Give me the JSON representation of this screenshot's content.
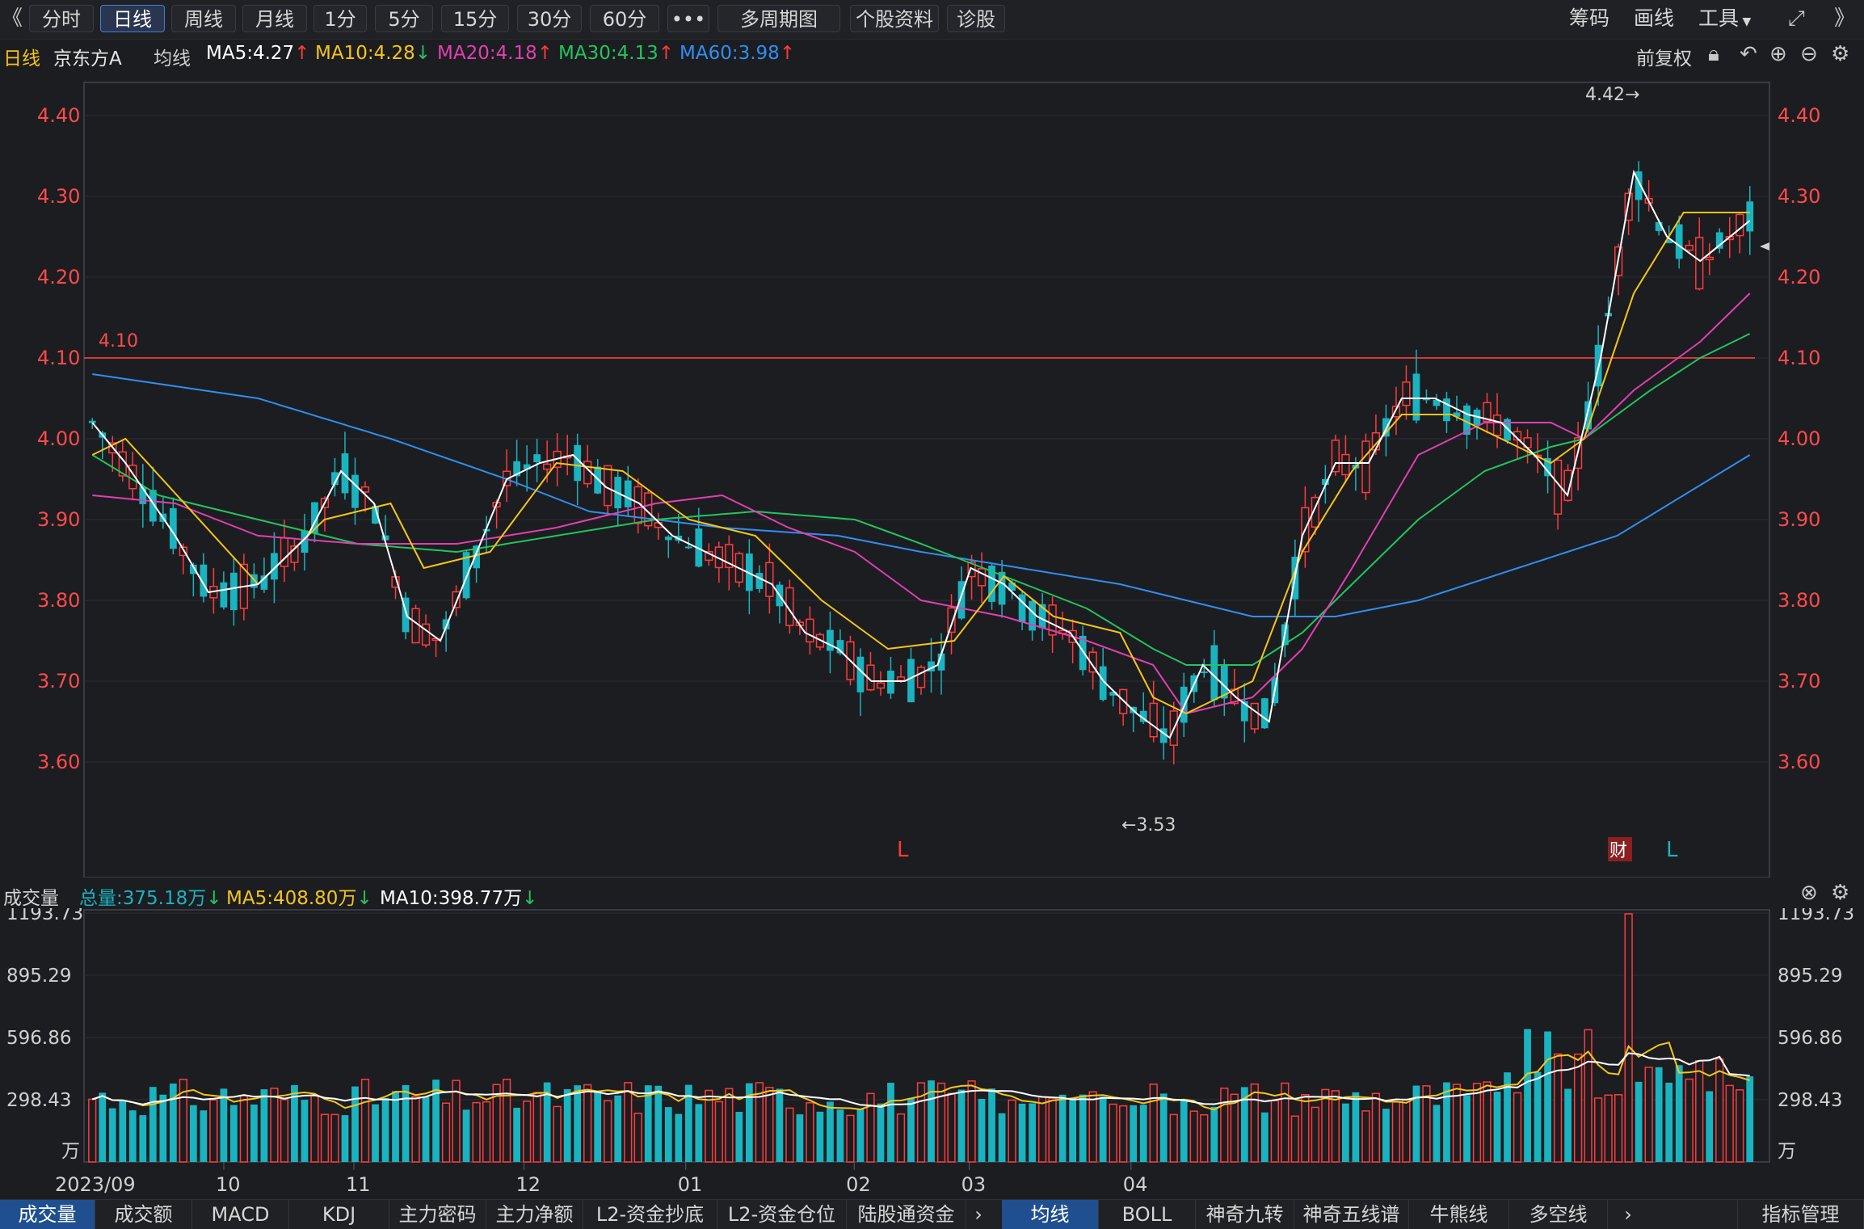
{
  "toolbar": {
    "collapse_left": "《",
    "tabs": [
      "分时",
      "日线",
      "周线",
      "月线",
      "1分",
      "5分",
      "15分",
      "30分",
      "60分",
      "•••",
      "多周期图",
      "个股资料",
      "诊股"
    ],
    "active_tab": "日线",
    "right_tools": [
      "筹码",
      "画线",
      "工具"
    ],
    "expand_right": "》"
  },
  "info": {
    "period": "日线",
    "stock_name": "京东方A",
    "ma_label": "均线",
    "ma5": "MA5:4.27",
    "ma10": "MA10:4.28",
    "ma20": "MA20:4.18",
    "ma30": "MA30:4.13",
    "ma60": "MA60:3.98",
    "adjust": "前复权"
  },
  "colors": {
    "up": "#ff3b3b",
    "down": "#1ab3c0",
    "ma5": "#ffffff",
    "ma10": "#f5c518",
    "ma20": "#e040b0",
    "ma30": "#22c55e",
    "ma60": "#2f8ff0",
    "grid": "#2c2d33",
    "ref_line": "#d33a3a"
  },
  "price_axis": {
    "ticks": [
      "4.40",
      "4.30",
      "4.20",
      "4.10",
      "4.00",
      "3.90",
      "3.80",
      "3.70",
      "3.60"
    ],
    "ref_line_label": "4.10",
    "high_label": "4.42→",
    "low_label": "←3.53",
    "markers": [
      "L",
      "财",
      "L"
    ]
  },
  "volume": {
    "title": "成交量",
    "total": "总量:375.18万",
    "ma5": "MA5:408.80万",
    "ma10": "MA10:398.77万",
    "ticks": [
      "1193.73",
      "895.29",
      "596.86",
      "298.43"
    ],
    "unit": "万"
  },
  "x_labels": [
    "2023/09",
    "10",
    "11",
    "12",
    "01",
    "02",
    "03",
    "04"
  ],
  "bottom_tabs_left": [
    "成交量",
    "成交额",
    "MACD",
    "KDJ",
    "主力密码",
    "主力净额",
    "L2-资金抄底",
    "L2-资金仓位",
    "陆股通资金"
  ],
  "bottom_tabs_right": [
    "均线",
    "BOLL",
    "神奇九转",
    "神奇五线谱",
    "牛熊线",
    "多空线"
  ],
  "indicator_manage": "指标管理",
  "chart_data": {
    "type": "candlestick",
    "title": "京东方A 日线",
    "ylim": [
      3.5,
      4.45
    ],
    "volume_ylim": [
      0,
      1193.73
    ],
    "ma60_path": [
      [
        0,
        4.08
      ],
      [
        0.1,
        4.05
      ],
      [
        0.18,
        4.0
      ],
      [
        0.25,
        3.95
      ],
      [
        0.3,
        3.91
      ],
      [
        0.38,
        3.89
      ],
      [
        0.45,
        3.88
      ],
      [
        0.5,
        3.86
      ],
      [
        0.56,
        3.84
      ],
      [
        0.62,
        3.82
      ],
      [
        0.66,
        3.8
      ],
      [
        0.7,
        3.78
      ],
      [
        0.75,
        3.78
      ],
      [
        0.8,
        3.8
      ],
      [
        0.86,
        3.84
      ],
      [
        0.92,
        3.88
      ],
      [
        0.96,
        3.93
      ],
      [
        1,
        3.98
      ]
    ],
    "ma30_path": [
      [
        0,
        3.98
      ],
      [
        0.04,
        3.93
      ],
      [
        0.1,
        3.9
      ],
      [
        0.16,
        3.87
      ],
      [
        0.22,
        3.86
      ],
      [
        0.28,
        3.88
      ],
      [
        0.34,
        3.9
      ],
      [
        0.4,
        3.91
      ],
      [
        0.46,
        3.9
      ],
      [
        0.5,
        3.87
      ],
      [
        0.55,
        3.83
      ],
      [
        0.6,
        3.79
      ],
      [
        0.64,
        3.74
      ],
      [
        0.66,
        3.72
      ],
      [
        0.7,
        3.72
      ],
      [
        0.73,
        3.76
      ],
      [
        0.76,
        3.82
      ],
      [
        0.8,
        3.9
      ],
      [
        0.84,
        3.96
      ],
      [
        0.88,
        3.99
      ],
      [
        0.9,
        4.0
      ],
      [
        0.94,
        4.06
      ],
      [
        0.97,
        4.1
      ],
      [
        1,
        4.13
      ]
    ],
    "ma20_path": [
      [
        0,
        3.93
      ],
      [
        0.05,
        3.92
      ],
      [
        0.1,
        3.88
      ],
      [
        0.16,
        3.87
      ],
      [
        0.22,
        3.87
      ],
      [
        0.28,
        3.89
      ],
      [
        0.34,
        3.92
      ],
      [
        0.38,
        3.93
      ],
      [
        0.42,
        3.89
      ],
      [
        0.46,
        3.86
      ],
      [
        0.5,
        3.8
      ],
      [
        0.55,
        3.78
      ],
      [
        0.6,
        3.75
      ],
      [
        0.64,
        3.72
      ],
      [
        0.66,
        3.66
      ],
      [
        0.7,
        3.68
      ],
      [
        0.73,
        3.74
      ],
      [
        0.76,
        3.84
      ],
      [
        0.8,
        3.98
      ],
      [
        0.84,
        4.02
      ],
      [
        0.88,
        4.02
      ],
      [
        0.9,
        4.0
      ],
      [
        0.93,
        4.06
      ],
      [
        0.97,
        4.12
      ],
      [
        1,
        4.18
      ]
    ],
    "ma10_path": [
      [
        0,
        3.98
      ],
      [
        0.02,
        4.0
      ],
      [
        0.06,
        3.91
      ],
      [
        0.1,
        3.82
      ],
      [
        0.14,
        3.9
      ],
      [
        0.18,
        3.92
      ],
      [
        0.2,
        3.84
      ],
      [
        0.24,
        3.86
      ],
      [
        0.28,
        3.97
      ],
      [
        0.32,
        3.96
      ],
      [
        0.36,
        3.9
      ],
      [
        0.4,
        3.88
      ],
      [
        0.44,
        3.8
      ],
      [
        0.48,
        3.74
      ],
      [
        0.52,
        3.75
      ],
      [
        0.55,
        3.83
      ],
      [
        0.58,
        3.78
      ],
      [
        0.62,
        3.76
      ],
      [
        0.64,
        3.68
      ],
      [
        0.66,
        3.66
      ],
      [
        0.7,
        3.7
      ],
      [
        0.73,
        3.86
      ],
      [
        0.76,
        3.96
      ],
      [
        0.79,
        4.03
      ],
      [
        0.82,
        4.03
      ],
      [
        0.85,
        4.0
      ],
      [
        0.88,
        3.97
      ],
      [
        0.9,
        4.0
      ],
      [
        0.93,
        4.18
      ],
      [
        0.96,
        4.28
      ],
      [
        1,
        4.28
      ]
    ],
    "ma5_path": [
      [
        0,
        4.02
      ],
      [
        0.02,
        3.97
      ],
      [
        0.05,
        3.88
      ],
      [
        0.07,
        3.81
      ],
      [
        0.1,
        3.82
      ],
      [
        0.13,
        3.88
      ],
      [
        0.15,
        3.96
      ],
      [
        0.17,
        3.92
      ],
      [
        0.19,
        3.78
      ],
      [
        0.21,
        3.75
      ],
      [
        0.23,
        3.85
      ],
      [
        0.25,
        3.95
      ],
      [
        0.27,
        3.97
      ],
      [
        0.29,
        3.98
      ],
      [
        0.31,
        3.94
      ],
      [
        0.33,
        3.92
      ],
      [
        0.35,
        3.88
      ],
      [
        0.37,
        3.86
      ],
      [
        0.39,
        3.84
      ],
      [
        0.41,
        3.82
      ],
      [
        0.43,
        3.76
      ],
      [
        0.45,
        3.74
      ],
      [
        0.47,
        3.7
      ],
      [
        0.49,
        3.7
      ],
      [
        0.51,
        3.72
      ],
      [
        0.53,
        3.84
      ],
      [
        0.55,
        3.82
      ],
      [
        0.57,
        3.78
      ],
      [
        0.59,
        3.76
      ],
      [
        0.61,
        3.7
      ],
      [
        0.63,
        3.66
      ],
      [
        0.65,
        3.63
      ],
      [
        0.67,
        3.72
      ],
      [
        0.69,
        3.68
      ],
      [
        0.71,
        3.65
      ],
      [
        0.73,
        3.88
      ],
      [
        0.75,
        3.97
      ],
      [
        0.77,
        3.97
      ],
      [
        0.79,
        4.05
      ],
      [
        0.81,
        4.05
      ],
      [
        0.83,
        4.03
      ],
      [
        0.85,
        4.02
      ],
      [
        0.87,
        3.98
      ],
      [
        0.89,
        3.93
      ],
      [
        0.91,
        4.1
      ],
      [
        0.93,
        4.33
      ],
      [
        0.95,
        4.25
      ],
      [
        0.97,
        4.22
      ],
      [
        1,
        4.27
      ]
    ],
    "note": "Candles and volume bars are rendered procedurally with approximate shape."
  }
}
